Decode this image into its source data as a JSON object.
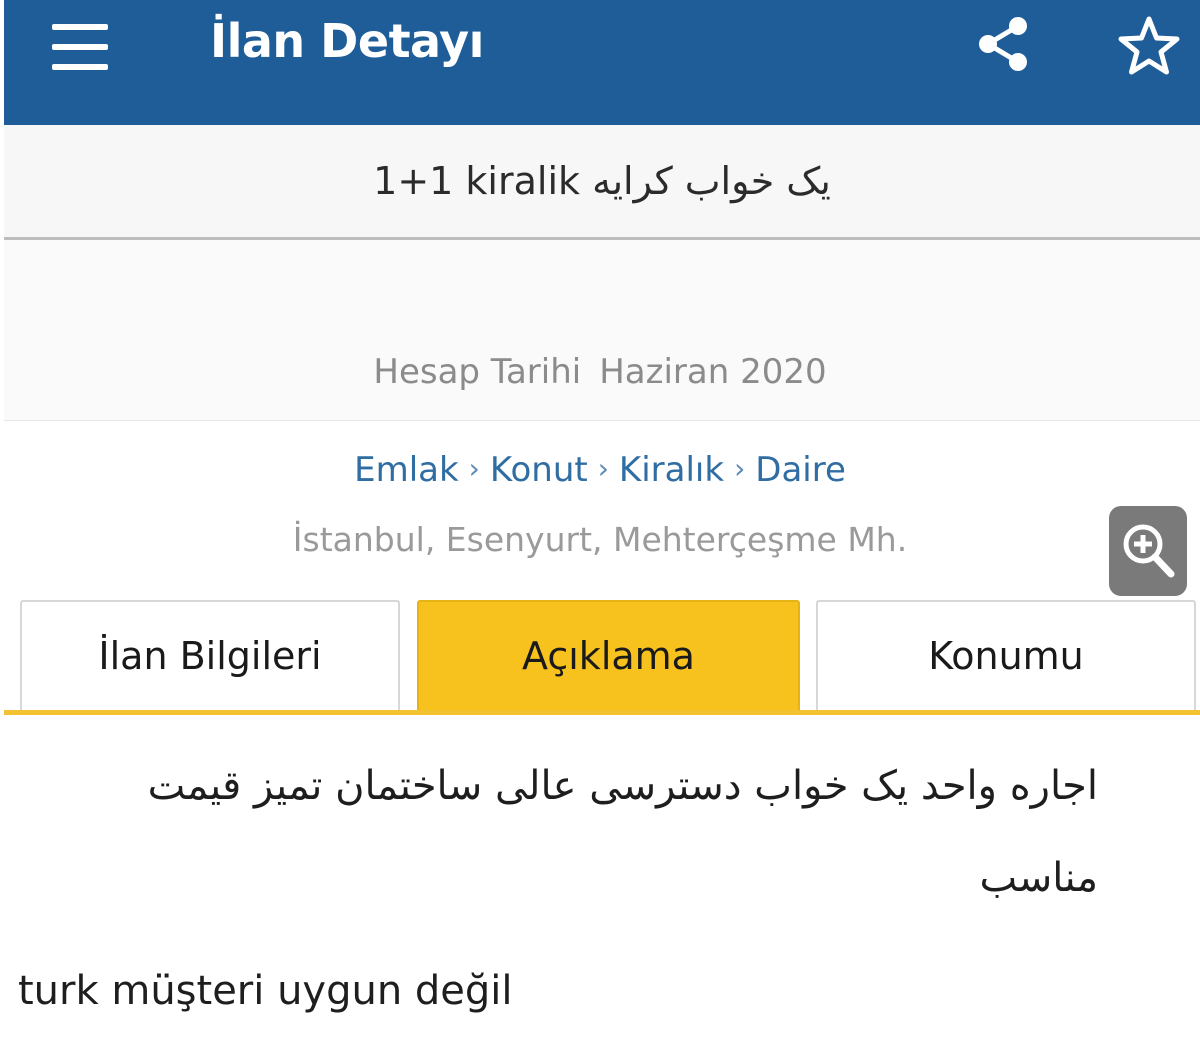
{
  "app_bar": {
    "title": "İlan Detayı",
    "menu_icon": "hamburger-menu-icon",
    "share_icon": "share-icon",
    "favorite_icon": "star-outline-icon",
    "background_color": "#1f5d99"
  },
  "listing": {
    "title": "1+1 kiralik یک خواب کرایه"
  },
  "account": {
    "label": "Hesap Tarihi",
    "date": "Haziran 2020"
  },
  "breadcrumb": {
    "items": [
      "Emlak",
      "Konut",
      "Kiralık",
      "Daire"
    ],
    "separator": "›",
    "color": "#2f6da3"
  },
  "location": "İstanbul, Esenyurt, Mehterçeşme Mh.",
  "zoom_button": {
    "icon": "zoom-in-icon"
  },
  "tabs": [
    {
      "label": "İlan Bilgileri",
      "active": false
    },
    {
      "label": "Açıklama",
      "active": true
    },
    {
      "label": "Konumu",
      "active": false
    }
  ],
  "active_tab_color": "#f7c21e",
  "description": {
    "persian": "اجاره واحد یک خواب دسترسی عالی ساختمان تمیز قیمت مناسب",
    "note": "turk  müşteri uygun değil"
  }
}
